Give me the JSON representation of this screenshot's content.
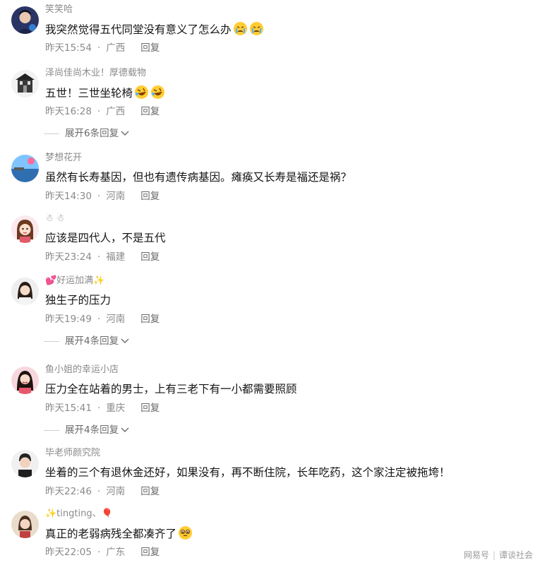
{
  "comments": [
    {
      "name": "笑笑哈",
      "text": "我突然觉得五代同堂没有意义了怎么办",
      "time": "昨天15:54",
      "region": "广西",
      "reply": "回复",
      "emoji": "crying-face"
    },
    {
      "name": "泽尚佳尚木业！厚德载物",
      "text": "五世！三世坐轮椅",
      "time": "昨天16:28",
      "region": "广西",
      "reply": "回复",
      "emoji": "rolling-laugh",
      "expand": "展开6条回复"
    },
    {
      "name": "梦想花开",
      "text": "虽然有长寿基因，但也有遗传病基因。瘫痪又长寿是福还是祸？",
      "time": "昨天14:30",
      "region": "河南",
      "reply": "回复"
    },
    {
      "name": "☃ ☃",
      "text": "应该是四代人，不是五代",
      "time": "昨天23:24",
      "region": "福建",
      "reply": "回复"
    },
    {
      "name": "💕好运加满✨",
      "text": "独生子的压力",
      "time": "昨天19:49",
      "region": "河南",
      "reply": "回复",
      "expand": "展开4条回复"
    },
    {
      "name": "鱼小姐的幸运小店",
      "text": "压力全在站着的男士，上有三老下有一小都需要照顾",
      "time": "昨天15:41",
      "region": "重庆",
      "reply": "回复",
      "expand": "展开4条回复"
    },
    {
      "name": "毕老师颜究院",
      "text": "坐着的三个有退休金还好，如果没有，再不断住院，长年吃药，这个家注定被拖垮！",
      "time": "昨天22:46",
      "region": "河南",
      "reply": "回复"
    },
    {
      "name": "✨tingting、🎈",
      "text": "真正的老弱病残全都凑齐了",
      "time": "昨天22:05",
      "region": "广东",
      "reply": "回复",
      "emoji": "pleading-face"
    }
  ],
  "watermark": {
    "brand": "网易号",
    "account": "谭谈社会"
  },
  "colors": {
    "name": "#8a8a8a",
    "text": "#141414",
    "meta": "#8a8a8a",
    "background": "#ffffff"
  }
}
